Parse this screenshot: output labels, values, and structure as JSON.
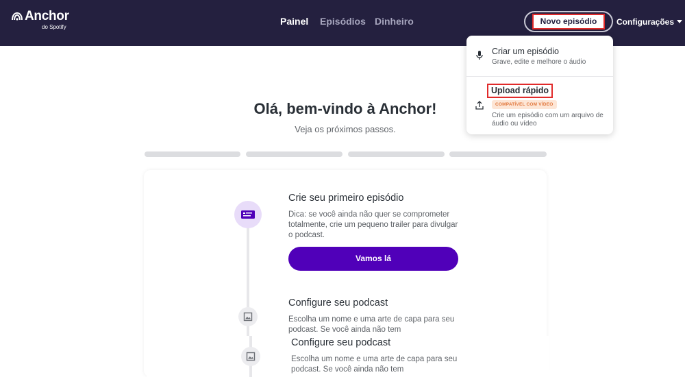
{
  "header": {
    "logo_text": "Anchor",
    "logo_sub": "do Spotify",
    "nav": [
      {
        "label": "Painel",
        "active": true
      },
      {
        "label": "Episódios",
        "active": false
      },
      {
        "label": "Dinheiro",
        "active": false
      }
    ],
    "new_episode_label": "Novo episódio",
    "settings_label": "Configurações"
  },
  "dropdown": {
    "items": [
      {
        "title": "Criar um episódio",
        "desc": "Grave, edite e melhore o áudio",
        "icon": "microphone-icon"
      },
      {
        "title": "Upload rápido",
        "badge": "COMPATÍVEL COM VÍDEO",
        "desc": "Crie um episódio com um arquivo de áudio ou vídeo",
        "icon": "upload-icon"
      }
    ]
  },
  "welcome": {
    "title": "Olá, bem-vindo à Anchor!",
    "subtitle": "Veja os próximos passos."
  },
  "progress": {
    "segments": 4,
    "completed": 0
  },
  "steps": [
    {
      "title": "Crie seu primeiro episódio",
      "desc": "Dica: se você ainda não quer se comprometer totalmente, crie um pequeno trailer para divulgar o podcast.",
      "cta": "Vamos lá",
      "icon": "episode-card-icon"
    },
    {
      "title": "Configure seu podcast",
      "desc": "Escolha um nome e uma arte de capa para seu podcast. Se você ainda não tem",
      "icon": "image-icon"
    },
    {
      "title": "Configure seu podcast",
      "desc": "Escolha um nome e uma arte de capa para seu podcast. Se você ainda não tem",
      "icon": "image-icon"
    }
  ],
  "colors": {
    "header_bg": "#24203f",
    "accent": "#5000b9",
    "highlight": "#e12a2a",
    "badge_bg": "#fde6d6",
    "badge_text": "#e1763b"
  }
}
